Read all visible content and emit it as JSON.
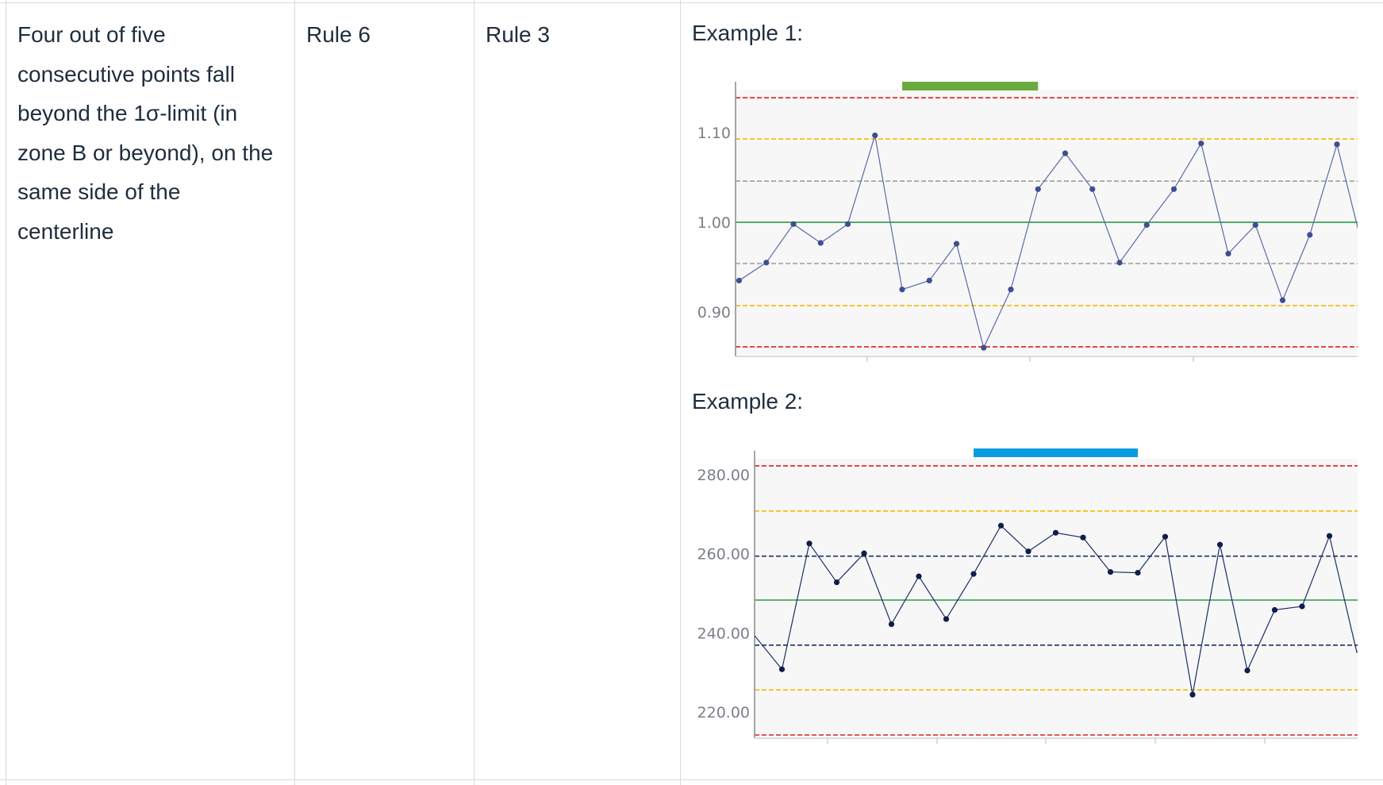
{
  "row": {
    "description": "Four out of five consecutive points fall beyond the 1σ-limit (in zone B or beyond), on the same side of the centerline",
    "description_lines": [
      "Four out of five",
      "consecutive points fall",
      "beyond the 1σ-limit (in",
      "zone B or beyond), on the",
      "same side of the",
      "centerline"
    ],
    "rule_a": "Rule 6",
    "rule_b": "Rule 3",
    "example1_label": "Example 1:",
    "example2_label": "Example 2:"
  },
  "chart_data": [
    {
      "type": "line",
      "ylim": [
        0.853,
        1.148
      ],
      "yticks": [
        "1.10",
        "1.00",
        "0.90"
      ],
      "ytick_values": [
        1.1,
        1.0,
        0.9
      ],
      "control_lines": {
        "ucl": 1.139,
        "zone_ab_upper": 1.093,
        "zone_bc_upper": 1.046,
        "center": 1.0,
        "zone_bc_lower": 0.954,
        "zone_ab_lower": 0.907,
        "lcl": 0.861
      },
      "series": [
        {
          "values": [
            0.935,
            0.955,
            0.998,
            0.977,
            0.998,
            1.097,
            0.925,
            0.935,
            0.976,
            0.86,
            0.925,
            1.037,
            1.077,
            1.037,
            0.955,
            0.997,
            1.037,
            1.088,
            0.965,
            0.997,
            0.913,
            0.986,
            1.087,
            0.965
          ]
        }
      ],
      "highlight": {
        "from_index": 6,
        "to_index": 11,
        "color": "#6aab3e"
      },
      "colors": {
        "ucl_lcl": "#e02020",
        "zone_ab": "#f5b800",
        "zone_bc": "#9e9e9e",
        "center": "#2e9a4a",
        "line": "#5a6aa8",
        "point": "#3e4e92",
        "plot_bg": "#f7f7f7"
      }
    },
    {
      "type": "line",
      "ylim": [
        214,
        284
      ],
      "yticks": [
        "280.00",
        "260.00",
        "240.00",
        "220.00"
      ],
      "ytick_values": [
        280,
        260,
        240,
        220
      ],
      "control_lines": {
        "ucl": 282.2,
        "zone_ab_upper": 270.8,
        "zone_bc_upper": 259.4,
        "center": 248.3,
        "zone_bc_lower": 236.9,
        "zone_ab_lower": 225.6,
        "lcl": 214.2
      },
      "series": [
        {
          "values": [
            239.3,
            230.8,
            262.6,
            252.8,
            260.1,
            242.2,
            254.3,
            243.5,
            254.9,
            267.1,
            260.6,
            265.3,
            264.1,
            255.4,
            255.2,
            264.3,
            224.4,
            262.3,
            230.5,
            245.8,
            246.7,
            264.5,
            235.1,
            239.2
          ]
        }
      ],
      "highlight": {
        "from_index": 8,
        "to_index": 14,
        "color": "#0a9ce0"
      },
      "colors": {
        "ucl_lcl": "#e02020",
        "zone_ab": "#f5b800",
        "zone_bc": "#1c2f66",
        "center": "#2e9a4a",
        "line": "#1c2f66",
        "point": "#0f1e4a",
        "plot_bg": "#f7f7f7"
      }
    }
  ]
}
